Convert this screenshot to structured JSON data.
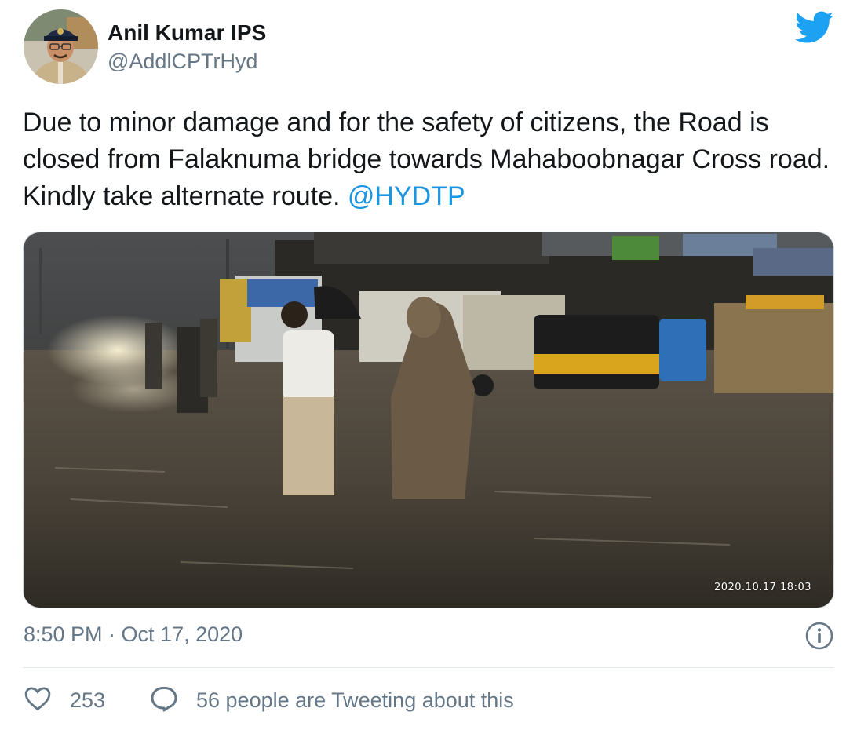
{
  "tweet": {
    "author": {
      "name": "Anil Kumar IPS",
      "handle": "@AddlCPTrHyd",
      "avatar_icon": "profile-photo-avatar"
    },
    "brand": {
      "icon": "twitter-bird-icon",
      "color": "#1da1f2"
    },
    "text": "Due to minor damage and for the safety of citizens, the Road is closed from Falaknuma bridge towards Mahaboobnagar Cross road. Kindly take alternate route.",
    "mention": "@HYDTP",
    "media": {
      "stamp": "2020.10.17 18:03",
      "description_icon": "photo-flooded-road"
    },
    "timestamp": "8:50 PM · Oct 17, 2020",
    "info_icon": "info-icon",
    "likes": "253",
    "conversation": "56 people are Tweeting about this"
  },
  "colors": {
    "text": "#14171a",
    "secondary": "#657786",
    "link": "#1b95e0",
    "divider": "#e1e8ed"
  }
}
